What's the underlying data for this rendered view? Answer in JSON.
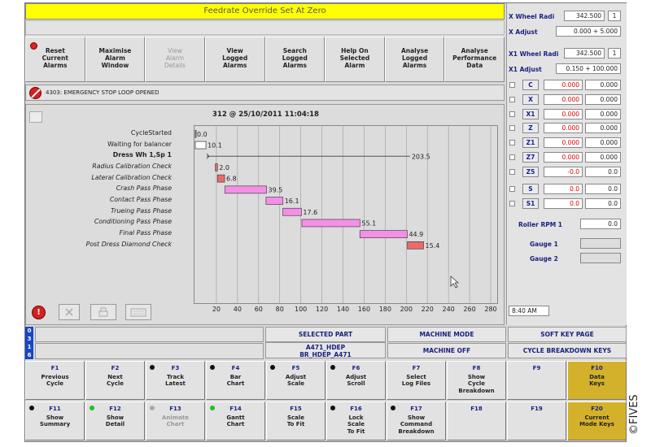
{
  "banner": {
    "text": "Feedrate Override Set At Zero"
  },
  "top_buttons": [
    {
      "label": "Reset\nCurrent\nAlarms",
      "disabled": false
    },
    {
      "label": "Maximise\nAlarm\nWindow",
      "disabled": false
    },
    {
      "label": "View\nAlarm\nDetails",
      "disabled": true
    },
    {
      "label": "View\nLogged\nAlarms",
      "disabled": false
    },
    {
      "label": "Search\nLogged\nAlarms",
      "disabled": false
    },
    {
      "label": "Help On\nSelected\nAlarm",
      "disabled": false
    },
    {
      "label": "Analyse\nLogged\nAlarms",
      "disabled": false
    },
    {
      "label": "Analyse\nPerformance\nData",
      "disabled": false
    }
  ],
  "alarm": {
    "text": "4303: EMERGENCY STOP LOOP OPENED"
  },
  "chart_data": {
    "type": "gantt",
    "title": "312 @ 25/10/2011 11:04:18",
    "xlim": [
      0,
      280
    ],
    "xticks": [
      20,
      40,
      60,
      80,
      100,
      120,
      140,
      160,
      180,
      200,
      220,
      240,
      260,
      280
    ],
    "rows": [
      {
        "label": "CycleStarted",
        "start": 0,
        "duration": 0.0,
        "value_label": "0.0",
        "style": "normal"
      },
      {
        "label": "Waiting for balancer",
        "start": 0,
        "duration": 10.1,
        "value_label": "10.1",
        "style": "normal"
      },
      {
        "label": "Dress Wh 1,Sp 1",
        "start": 0,
        "duration": 203.5,
        "value_label": "203.5",
        "style": "bold"
      },
      {
        "label": "Radius Calibration Check",
        "start": 19,
        "duration": 2.0,
        "value_label": "2.0",
        "style": "italic"
      },
      {
        "label": "Lateral Calibration Check",
        "start": 21,
        "duration": 6.8,
        "value_label": "6.8",
        "style": "italic"
      },
      {
        "label": "Crash Pass Phase",
        "start": 28,
        "duration": 39.5,
        "value_label": "39.5",
        "style": "italic"
      },
      {
        "label": "Contact Pass Phase",
        "start": 67,
        "duration": 16.1,
        "value_label": "16.1",
        "style": "italic"
      },
      {
        "label": "Trueing Pass Phase",
        "start": 83,
        "duration": 17.6,
        "value_label": "17.6",
        "style": "italic"
      },
      {
        "label": "Conditioning Pass Phase",
        "start": 101,
        "duration": 55.1,
        "value_label": "55.1",
        "style": "italic"
      },
      {
        "label": "Final Pass Phase",
        "start": 156,
        "duration": 44.9,
        "value_label": "44.9",
        "style": "italic"
      },
      {
        "label": "Post Dress Diamond Check",
        "start": 201,
        "duration": 15.4,
        "value_label": "15.4",
        "style": "italic"
      }
    ],
    "colors": {
      "pink": "#f58fe6",
      "red": "#e86a6a",
      "grid": "#9a9a9a"
    }
  },
  "right_panel": {
    "x_wheel_radi": {
      "label": "X Wheel Radi",
      "value": "342.500",
      "index": "1"
    },
    "x_adjust": {
      "label": "X Adjust",
      "value": "0.000 + 5.000"
    },
    "x1_wheel_radi": {
      "label": "X1 Wheel Radi",
      "value": "342.500",
      "index": "1"
    },
    "x1_adjust": {
      "label": "X1 Adjust",
      "value": "0.150 + 100.000"
    },
    "axes": [
      {
        "name": "C",
        "v1": "0.000",
        "v2": "0.000"
      },
      {
        "name": "X",
        "v1": "0.000",
        "v2": "0.000"
      },
      {
        "name": "X1",
        "v1": "0.000",
        "v2": "0.000"
      },
      {
        "name": "Z",
        "v1": "0.000",
        "v2": "0.000"
      },
      {
        "name": "Z1",
        "v1": "0.000",
        "v2": "0.000"
      },
      {
        "name": "Z7",
        "v1": "0.000",
        "v2": "0.000"
      },
      {
        "name": "Z5",
        "v1": "-0.0",
        "v2": "0.0"
      }
    ],
    "spindles": [
      {
        "name": "S",
        "v1": "0.0",
        "v2": "0.0"
      },
      {
        "name": "S1",
        "v1": "0.0",
        "v2": "0.0"
      }
    ],
    "roller_rpm": {
      "label": "Roller RPM 1",
      "value": "0.0"
    },
    "gauge1": {
      "label": "Gauge 1"
    },
    "gauge2": {
      "label": "Gauge 2"
    },
    "time": "8:40 AM"
  },
  "status": {
    "nav_digits": [
      "0",
      "3",
      "1",
      "6"
    ],
    "selected_part_label": "SELECTED PART",
    "selected_part_value": "A471_HDEP\nBR_HDEP_A471",
    "machine_mode_label": "MACHINE MODE",
    "machine_mode_value": "MACHINE OFF",
    "soft_key_label": "SOFT KEY PAGE",
    "soft_key_value": "CYCLE BREAKDOWN KEYS"
  },
  "fkeys": [
    {
      "fn": "F1",
      "label": "Previous\nCycle",
      "dot": "",
      "style": ""
    },
    {
      "fn": "F2",
      "label": "Next\nCycle",
      "dot": "",
      "style": ""
    },
    {
      "fn": "F3",
      "label": "Track\nLatest",
      "dot": "black",
      "style": ""
    },
    {
      "fn": "F4",
      "label": "Bar\nChart",
      "dot": "black",
      "style": ""
    },
    {
      "fn": "F5",
      "label": "Adjust\nScale",
      "dot": "black",
      "style": ""
    },
    {
      "fn": "F6",
      "label": "Adjust\nScroll",
      "dot": "black",
      "style": ""
    },
    {
      "fn": "F7",
      "label": "Select\nLog Files",
      "dot": "",
      "style": ""
    },
    {
      "fn": "F8",
      "label": "Show\nCycle\nBreakdown",
      "dot": "",
      "style": ""
    },
    {
      "fn": "F9",
      "label": "",
      "dot": "",
      "style": ""
    },
    {
      "fn": "F10",
      "label": "Data\nKeys",
      "dot": "",
      "style": "gold"
    },
    {
      "fn": "F11",
      "label": "Show\nSummary",
      "dot": "black",
      "style": ""
    },
    {
      "fn": "F12",
      "label": "Show\nDetail",
      "dot": "green",
      "style": ""
    },
    {
      "fn": "F13",
      "label": "Animate\nChart",
      "dot": "grey",
      "style": "disabled"
    },
    {
      "fn": "F14",
      "label": "Gantt\nChart",
      "dot": "green",
      "style": ""
    },
    {
      "fn": "F15",
      "label": "Scale\nTo Fit",
      "dot": "",
      "style": ""
    },
    {
      "fn": "F16",
      "label": "Lock\nScale\nTo Fit",
      "dot": "black",
      "style": ""
    },
    {
      "fn": "F17",
      "label": "Show\nCommand\nBreakdown",
      "dot": "black",
      "style": ""
    },
    {
      "fn": "F18",
      "label": "",
      "dot": "",
      "style": ""
    },
    {
      "fn": "F19",
      "label": "",
      "dot": "",
      "style": ""
    },
    {
      "fn": "F20",
      "label": "Current\nMode Keys",
      "dot": "",
      "style": "gold"
    }
  ],
  "watermark": "©FIVES"
}
